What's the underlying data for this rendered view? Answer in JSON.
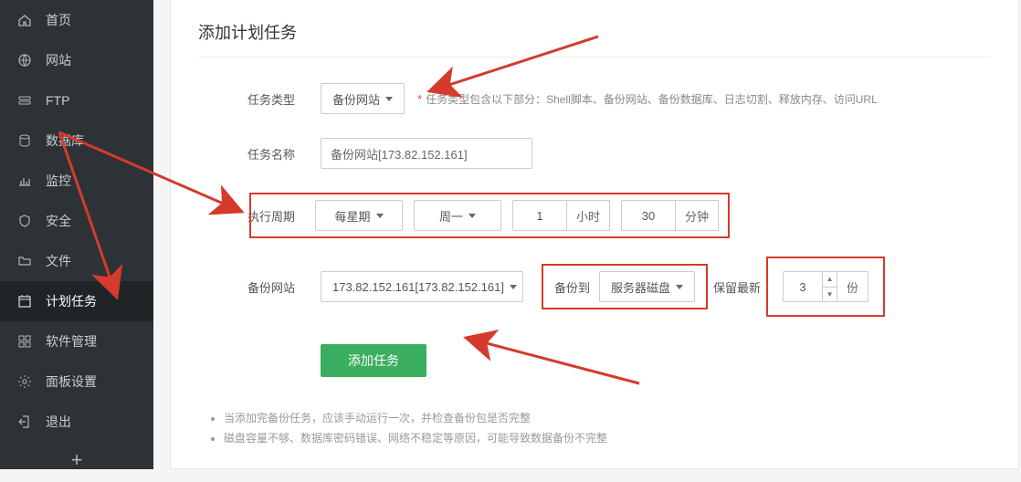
{
  "sidebar": {
    "items": [
      {
        "label": "首页"
      },
      {
        "label": "网站"
      },
      {
        "label": "FTP"
      },
      {
        "label": "数据库"
      },
      {
        "label": "监控"
      },
      {
        "label": "安全"
      },
      {
        "label": "文件"
      },
      {
        "label": "计划任务"
      },
      {
        "label": "软件管理"
      },
      {
        "label": "面板设置"
      },
      {
        "label": "退出"
      }
    ],
    "add_label": "+"
  },
  "page": {
    "title": "添加计划任务"
  },
  "form": {
    "task_type": {
      "label": "任务类型",
      "value": "备份网站",
      "hint": "任务类型包含以下部分：Shell脚本、备份网站、备份数据库、日志切割、释放内存、访问URL"
    },
    "task_name": {
      "label": "任务名称",
      "value": "备份网站[173.82.152.161]"
    },
    "schedule": {
      "label": "执行周期",
      "freq": "每星期",
      "day": "周一",
      "hour": "1",
      "hour_suffix": "小时",
      "minute": "30",
      "minute_suffix": "分钟"
    },
    "backup_site": {
      "label": "备份网站",
      "site": "173.82.152.161[173.82.152.161]",
      "to_label": "备份到",
      "dest": "服务器磁盘",
      "keep_label": "保留最新",
      "keep_count": "3",
      "keep_suffix": "份"
    },
    "submit_label": "添加任务"
  },
  "notes": [
    "当添加完备份任务，应该手动运行一次，并检查备份包是否完整",
    "磁盘容量不够、数据库密码错误、网络不稳定等原因，可能导致数据备份不完整"
  ]
}
